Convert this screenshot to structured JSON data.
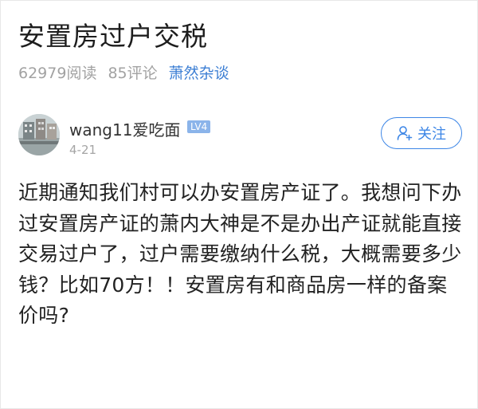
{
  "post": {
    "title": "安置房过户交税",
    "views": "62979阅读",
    "comments": "85评论",
    "forum": "萧然杂谈"
  },
  "author": {
    "name": "wang11爱吃面",
    "level": "LV4",
    "date": "4-21",
    "follow_label": "关注",
    "avatar": "avatar-image",
    "follow_icon": "user-add-icon"
  },
  "body": {
    "text": "近期通知我们村可以办安置房产证了。我想问下办过安置房产证的萧内大神是不是办出产证就能直接交易过户了，过户需要缴纳什么税，大概需要多少钱？比如70方！！安置房有和商品房一样的备案价吗?"
  },
  "colors": {
    "accent": "#3d86e6",
    "forum_link": "#3d7fd4",
    "meta_gray": "#a2a2a2",
    "level_badge": "#8bb4ea"
  }
}
